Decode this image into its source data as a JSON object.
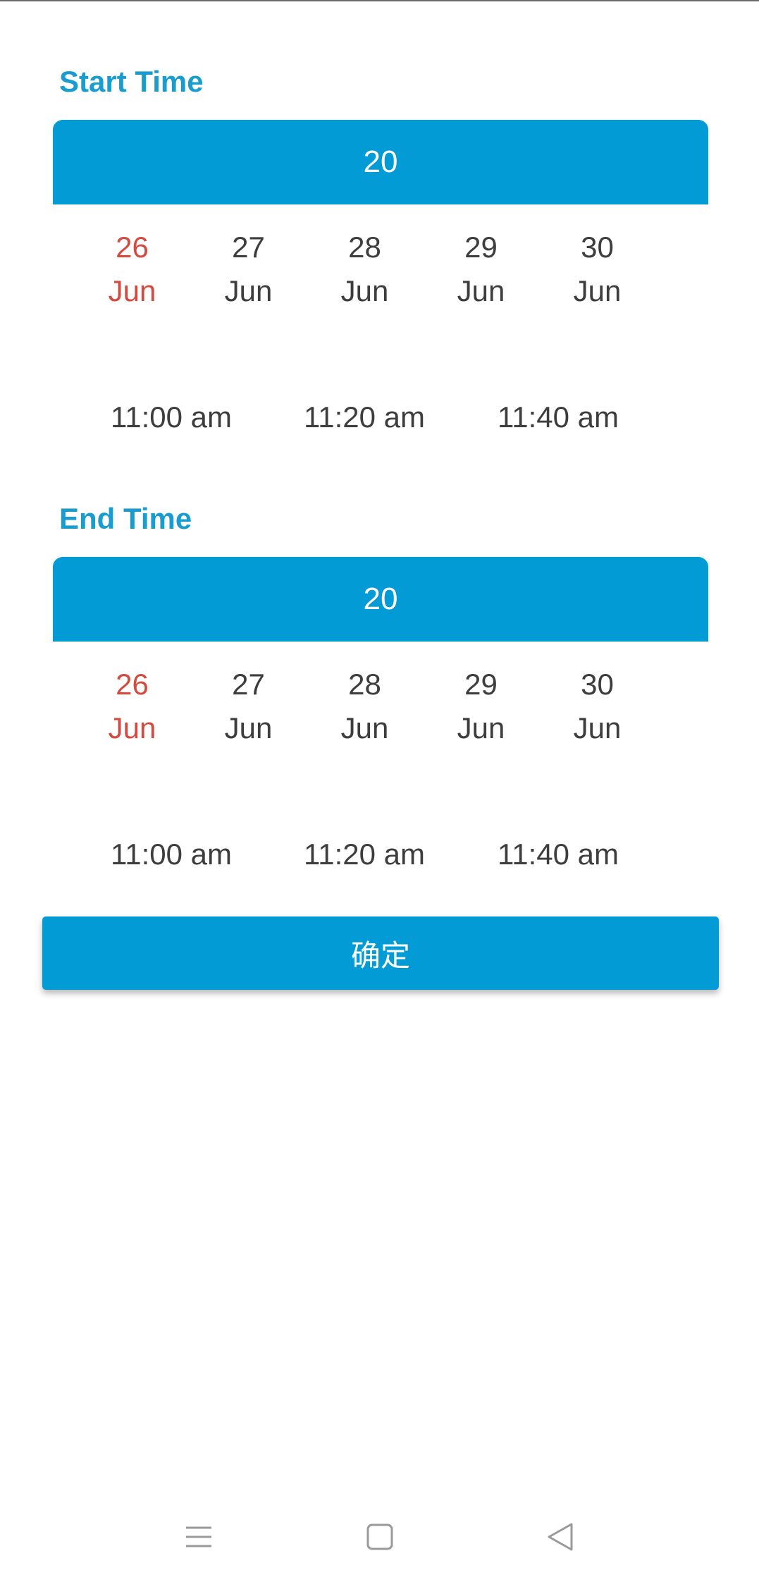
{
  "start": {
    "title": "Start Time",
    "hour": "20",
    "dates": [
      {
        "day": "26",
        "month": "Jun",
        "selected": true
      },
      {
        "day": "27",
        "month": "Jun",
        "selected": false
      },
      {
        "day": "28",
        "month": "Jun",
        "selected": false
      },
      {
        "day": "29",
        "month": "Jun",
        "selected": false
      },
      {
        "day": "30",
        "month": "Jun",
        "selected": false
      }
    ],
    "times": [
      "11:00 am",
      "11:20 am",
      "11:40 am"
    ]
  },
  "end": {
    "title": "End Time",
    "hour": "20",
    "dates": [
      {
        "day": "26",
        "month": "Jun",
        "selected": true
      },
      {
        "day": "27",
        "month": "Jun",
        "selected": false
      },
      {
        "day": "28",
        "month": "Jun",
        "selected": false
      },
      {
        "day": "29",
        "month": "Jun",
        "selected": false
      },
      {
        "day": "30",
        "month": "Jun",
        "selected": false
      }
    ],
    "times": [
      "11:00 am",
      "11:20 am",
      "11:40 am"
    ]
  },
  "confirm_label": "确定",
  "colors": {
    "accent": "#039bd6",
    "title": "#1a9ccf",
    "selected_date": "#d44a3e",
    "text": "#3d3d3d"
  },
  "nav": {
    "icons": [
      "menu-icon",
      "home-square-icon",
      "back-triangle-icon"
    ]
  }
}
